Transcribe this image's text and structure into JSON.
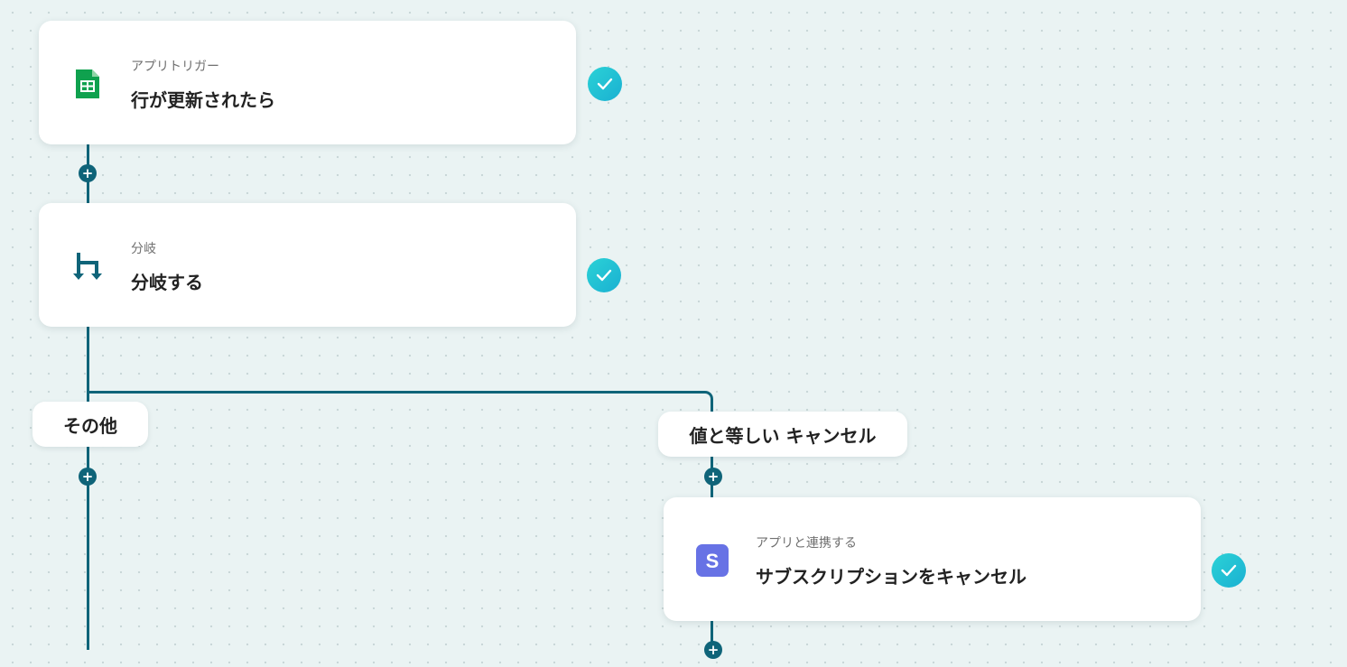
{
  "nodes": [
    {
      "subtitle": "アプリトリガー",
      "title": "行が更新されたら",
      "icon": "google-sheets-icon",
      "status": "completed"
    },
    {
      "subtitle": "分岐",
      "title": "分岐する",
      "icon": "branch-icon",
      "status": "completed"
    },
    {
      "subtitle": "アプリと連携する",
      "title": "サブスクリプションをキャンセル",
      "icon": "stripe-icon",
      "status": "completed"
    }
  ],
  "branches": {
    "other_label": "その他",
    "condition_label": "値と等しい キャンセル"
  },
  "colors": {
    "connector": "#0f6479",
    "check_gradient_start": "#2bd2d6",
    "check_gradient_end": "#1ab0d2",
    "sheets_green": "#0fa14e",
    "stripe_purple": "#6772e5",
    "branch_teal": "#0f6479"
  },
  "add_step_symbol": "+"
}
